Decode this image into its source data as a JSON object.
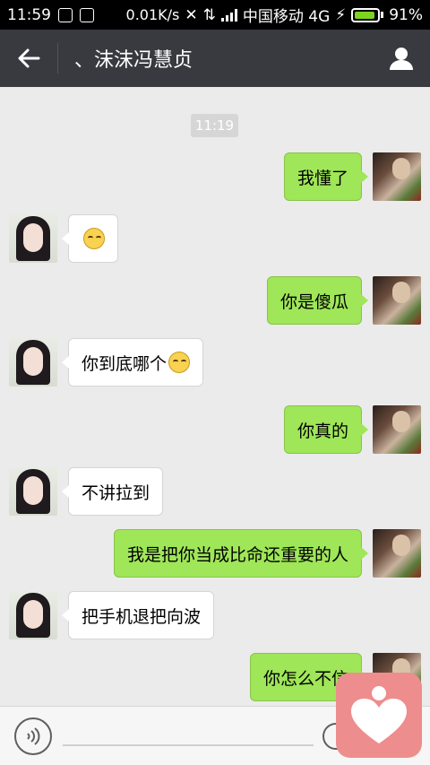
{
  "status_bar": {
    "time": "11:59",
    "speed": "0.01K/s",
    "carrier": "中国移动 4G",
    "battery_text": "91%",
    "battery_level": 0.91
  },
  "header": {
    "title": "、沫沫冯慧贞"
  },
  "chat": {
    "timestamp": "11:19",
    "messages": [
      {
        "side": "me",
        "text": "我懂了"
      },
      {
        "side": "them",
        "text": ""
      },
      {
        "side": "me",
        "text": "你是傻瓜"
      },
      {
        "side": "them",
        "text": "你到底哪个"
      },
      {
        "side": "me",
        "text": "你真的"
      },
      {
        "side": "them",
        "text": "不讲拉到"
      },
      {
        "side": "me",
        "text": "我是把你当成比命还重要的人"
      },
      {
        "side": "them",
        "text": "把手机退把向波"
      },
      {
        "side": "me",
        "text": "你怎么不信"
      }
    ]
  },
  "icons": {
    "back": "arrow-left-icon",
    "profile": "person-icon",
    "voice": "voice-icon",
    "emoji": "emoji-icon",
    "float_app": "heart-person-icon"
  },
  "colors": {
    "header_bg": "#393a3f",
    "bubble_me": "#9fe658",
    "bubble_them": "#ffffff",
    "chat_bg": "#ebebeb",
    "float_app_bg": "#ee8d8d"
  }
}
